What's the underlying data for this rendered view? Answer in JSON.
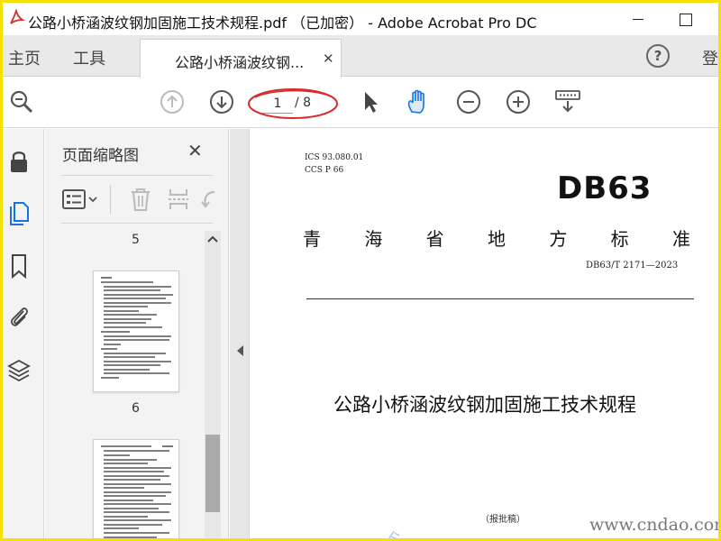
{
  "window": {
    "title": "公路小桥涵波纹钢加固施工技术规程.pdf （已加密） - Adobe Acrobat Pro DC"
  },
  "nav": {
    "home": "主页",
    "tools": "工具",
    "doc_tab": "公路小桥涵波纹钢...",
    "signin": "登"
  },
  "help": {
    "glyph": "?"
  },
  "toolbar": {
    "page_current": "1",
    "page_total": "/ 8"
  },
  "panel": {
    "title": "页面缩略图",
    "close_glyph": "✕",
    "thumbnails": [
      {
        "label": "5"
      },
      {
        "label": "6"
      }
    ]
  },
  "document": {
    "ics": "ICS  93.080.01",
    "ccs": "CCS  P  66",
    "db_code": "DB63",
    "standard_title_chars": [
      "青",
      "海",
      "省",
      "地",
      "方",
      "标",
      "准"
    ],
    "standard_number": "DB63/T 2171—2023",
    "main_title": "公路小桥涵波纹钢加固施工技术规程",
    "draft_note": "（报批稿）"
  },
  "watermark": {
    "text": "www.cndao.com"
  },
  "colors": {
    "frame_yellow": "#f2e400",
    "accent_blue": "#1473e6",
    "annotation_red": "#d92a2a",
    "acrobat_red": "#d0302f"
  }
}
